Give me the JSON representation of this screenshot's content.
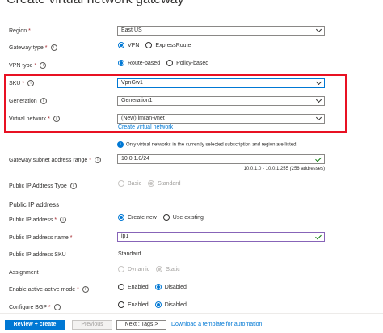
{
  "page": {
    "title": "Create virtual network gateway"
  },
  "form": {
    "region": {
      "label": "Region",
      "required": "*",
      "value": "East US"
    },
    "gateway_type": {
      "label": "Gateway type",
      "required": "*",
      "options": [
        "VPN",
        "ExpressRoute"
      ],
      "selected": "VPN"
    },
    "vpn_type": {
      "label": "VPN type",
      "required": "*",
      "options": [
        "Route-based",
        "Policy-based"
      ],
      "selected": "Route-based"
    },
    "sku": {
      "label": "SKU",
      "required": "*",
      "value": "VpnGw1"
    },
    "generation": {
      "label": "Generation",
      "value": "Generation1"
    },
    "virtual_network": {
      "label": "Virtual network",
      "required": "*",
      "value": "(New) imran-vnet",
      "create_link": "Create virtual network"
    },
    "vnet_notice": "Only virtual networks in the currently selected subscription and region are listed.",
    "gateway_subnet": {
      "label": "Gateway subnet address range",
      "required": "*",
      "value": "10.0.1.0/24",
      "hint": "10.0.1.0 - 10.0.1.255 (256 addresses)"
    },
    "public_ip_type": {
      "label": "Public IP Address Type",
      "options": [
        "Basic",
        "Standard"
      ],
      "selected": "Standard"
    },
    "public_ip_section": "Public IP address",
    "public_ip": {
      "label": "Public IP address",
      "required": "*",
      "options": [
        "Create new",
        "Use existing"
      ],
      "selected": "Create new"
    },
    "public_ip_name": {
      "label": "Public IP address name",
      "required": "*",
      "value": "ip1"
    },
    "public_ip_sku": {
      "label": "Public IP address SKU",
      "value": "Standard"
    },
    "assignment": {
      "label": "Assignment",
      "options": [
        "Dynamic",
        "Static"
      ],
      "selected": "Static"
    },
    "active_active": {
      "label": "Enable active-active mode",
      "required": "*",
      "options": [
        "Enabled",
        "Disabled"
      ],
      "selected": "Disabled"
    },
    "bgp": {
      "label": "Configure BGP",
      "required": "*",
      "options": [
        "Enabled",
        "Disabled"
      ],
      "selected": "Disabled"
    }
  },
  "footer": {
    "review_create": "Review + create",
    "previous": "Previous",
    "next": "Next : Tags >",
    "download_link": "Download a template for automation"
  },
  "colors": {
    "accent": "#0078d4",
    "highlight_box": "#e81123",
    "valid": "#107c10"
  }
}
